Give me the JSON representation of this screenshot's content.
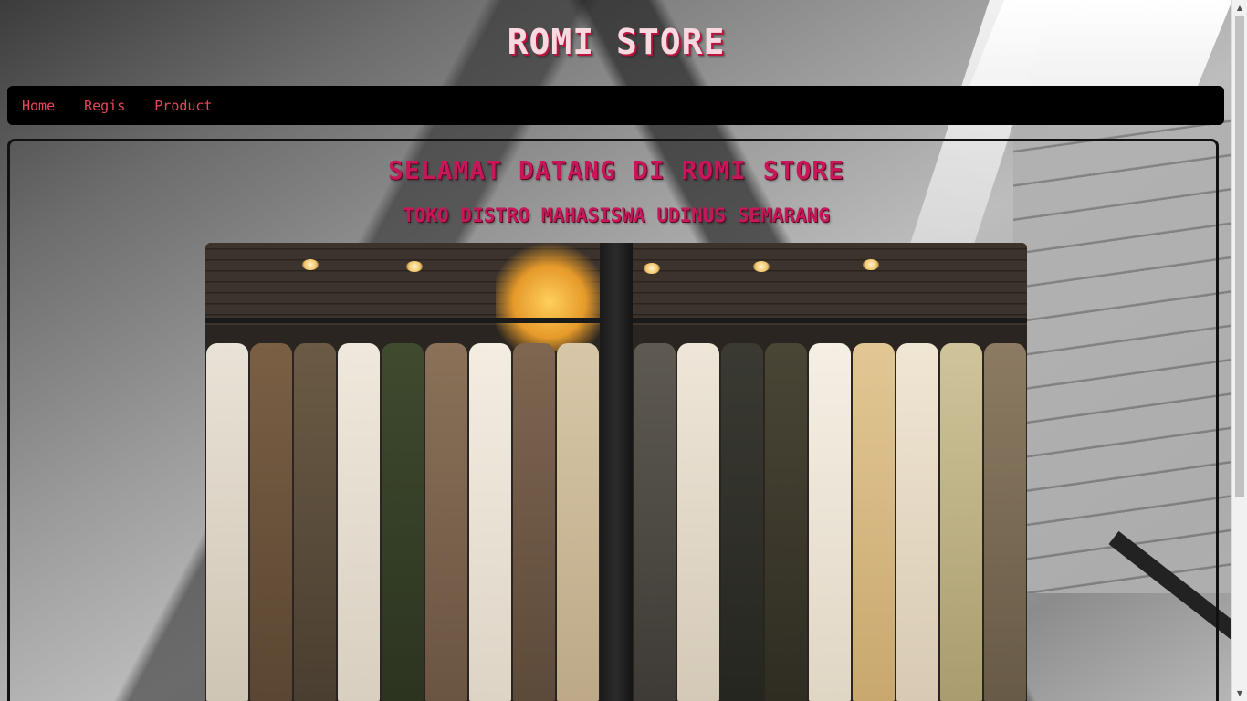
{
  "site": {
    "title": "ROMI STORE"
  },
  "nav": {
    "items": [
      {
        "label": "Home"
      },
      {
        "label": "Regis"
      },
      {
        "label": "Product"
      }
    ]
  },
  "main": {
    "heading": "SELAMAT DATANG DI ROMI STORE",
    "subheading": "TOKO DISTRO MAHASISWA UDINUS SEMARANG",
    "hero_image": "clothing-rack-photo"
  },
  "colors": {
    "title_text": "#f7d9df",
    "nav_bg": "#000000",
    "nav_link": "#e8465a",
    "heading": "#c8165a",
    "border": "#111111"
  },
  "scrollbar": {
    "up_icon": "scroll-up-arrow",
    "down_icon": "scroll-down-arrow"
  }
}
